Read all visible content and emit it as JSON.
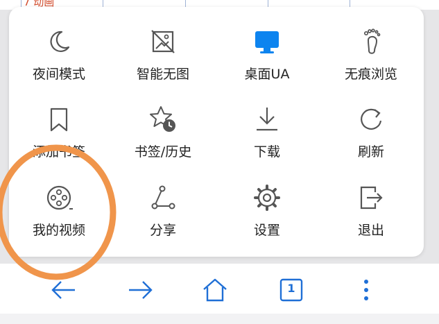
{
  "background": {
    "visible_text": "7 动画"
  },
  "menu": {
    "items": [
      {
        "label": "夜间模式",
        "icon": "moon-icon"
      },
      {
        "label": "智能无图",
        "icon": "no-image-icon"
      },
      {
        "label": "桌面UA",
        "icon": "desktop-monitor-icon"
      },
      {
        "label": "无痕浏览",
        "icon": "footprints-icon"
      },
      {
        "label": "添加书签",
        "icon": "bookmark-icon"
      },
      {
        "label": "书签/历史",
        "icon": "star-clock-icon"
      },
      {
        "label": "下载",
        "icon": "download-icon"
      },
      {
        "label": "刷新",
        "icon": "refresh-icon"
      },
      {
        "label": "我的视频",
        "icon": "film-reel-icon"
      },
      {
        "label": "分享",
        "icon": "share-icon"
      },
      {
        "label": "设置",
        "icon": "gear-icon"
      },
      {
        "label": "退出",
        "icon": "exit-icon"
      }
    ]
  },
  "bottombar": {
    "tab_count": "1",
    "icons": [
      "back-arrow-icon",
      "forward-arrow-icon",
      "home-icon",
      "tabs-icon",
      "more-vertical-icon"
    ]
  },
  "colors": {
    "accent": "#1f6fd6",
    "desktop_ua_active": "#0d84ef",
    "highlight_ring": "#f0954b",
    "panel": "#ffffff"
  }
}
